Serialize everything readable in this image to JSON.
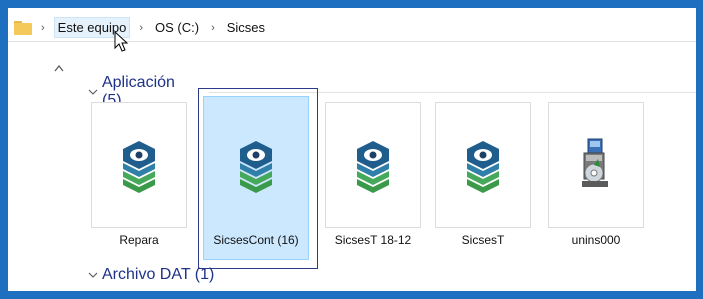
{
  "breadcrumb": {
    "items": [
      "Este equipo",
      "OS (C:)",
      "Sicses"
    ],
    "separator": "›",
    "leading_separator": "›"
  },
  "groups": [
    {
      "label": "Aplicación (5)",
      "expanded": true
    },
    {
      "label": "Archivo DAT (1)",
      "expanded": true
    }
  ],
  "files": [
    {
      "name": "Repara",
      "icon": "sicses-app-icon",
      "selected": false
    },
    {
      "name": "SicsesCont (16)",
      "icon": "sicses-app-icon",
      "selected": true
    },
    {
      "name": "SicsesT 18-12",
      "icon": "sicses-app-icon",
      "selected": false
    },
    {
      "name": "SicsesT",
      "icon": "sicses-app-icon",
      "selected": false
    },
    {
      "name": "unins000",
      "icon": "installer-icon",
      "selected": false
    }
  ],
  "colors": {
    "frame": "#1f6fc0",
    "selection": "#cce8ff",
    "group_header": "#1e3287",
    "highlight_box": "#2c3a8c"
  }
}
